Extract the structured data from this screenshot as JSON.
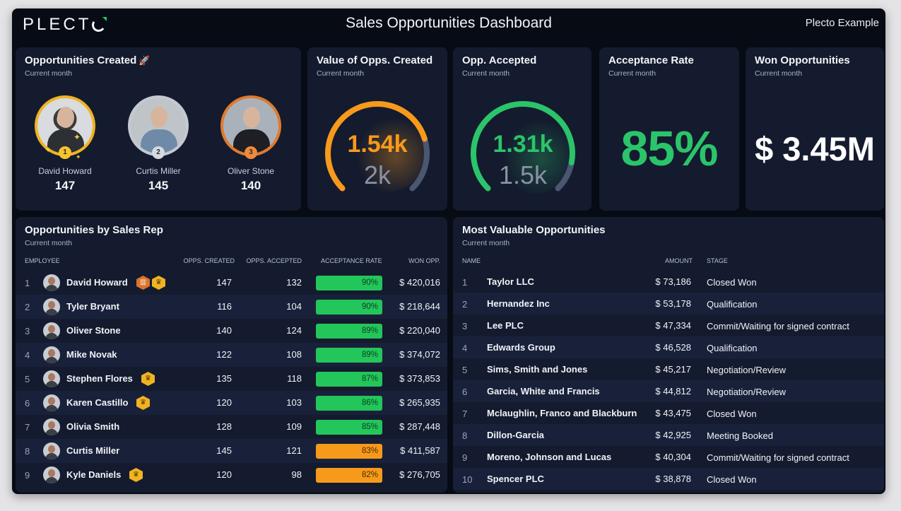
{
  "header": {
    "logo": "PLECT",
    "title": "Sales Opportunities Dashboard",
    "account": "Plecto Example",
    "accent_color": "#2bc46a"
  },
  "opps_created": {
    "title": "Opportunities Created",
    "title_icon": "rocket-icon",
    "subtitle": "Current month",
    "podium": [
      {
        "rank": "1",
        "name": "David Howard",
        "value": "147",
        "medal": "gold"
      },
      {
        "rank": "2",
        "name": "Curtis Miller",
        "value": "145",
        "medal": "silver"
      },
      {
        "rank": "3",
        "name": "Oliver Stone",
        "value": "140",
        "medal": "bronze"
      }
    ]
  },
  "value_created": {
    "title": "Value of Opps. Created",
    "subtitle": "Current month",
    "value": "1.54k",
    "target": "2k",
    "progress": 0.77,
    "color": "#f79a1b"
  },
  "opp_accepted": {
    "title": "Opp. Accepted",
    "subtitle": "Current month",
    "value": "1.31k",
    "target": "1.5k",
    "progress": 0.873,
    "color": "#2bc46a"
  },
  "acceptance_rate": {
    "title": "Acceptance Rate",
    "subtitle": "Current month",
    "value": "85%"
  },
  "won_opps": {
    "title": "Won Opportunities",
    "subtitle": "Current month",
    "value": "$ 3.45M"
  },
  "reps_table": {
    "title": "Opportunities by Sales Rep",
    "subtitle": "Current month",
    "columns": [
      "EMPLOYEE",
      "OPPS. CREATED",
      "OPPS. ACCEPTED",
      "ACCEPTANCE RATE",
      "WON OPP."
    ],
    "rows": [
      {
        "idx": "1",
        "name": "David Howard",
        "badges": [
          "cake",
          "trophy"
        ],
        "created": "147",
        "accepted": "132",
        "rate": "90%",
        "rate_status": "green",
        "won": "$ 420,016"
      },
      {
        "idx": "2",
        "name": "Tyler Bryant",
        "badges": [],
        "created": "116",
        "accepted": "104",
        "rate": "90%",
        "rate_status": "green",
        "won": "$ 218,644"
      },
      {
        "idx": "3",
        "name": "Oliver Stone",
        "badges": [],
        "created": "140",
        "accepted": "124",
        "rate": "89%",
        "rate_status": "green",
        "won": "$ 220,040"
      },
      {
        "idx": "4",
        "name": "Mike Novak",
        "badges": [],
        "created": "122",
        "accepted": "108",
        "rate": "89%",
        "rate_status": "green",
        "won": "$ 374,072"
      },
      {
        "idx": "5",
        "name": "Stephen Flores",
        "badges": [
          "trophy"
        ],
        "created": "135",
        "accepted": "118",
        "rate": "87%",
        "rate_status": "green",
        "won": "$ 373,853"
      },
      {
        "idx": "6",
        "name": "Karen Castillo",
        "badges": [
          "trophy"
        ],
        "created": "120",
        "accepted": "103",
        "rate": "86%",
        "rate_status": "green",
        "won": "$ 265,935"
      },
      {
        "idx": "7",
        "name": "Olivia Smith",
        "badges": [],
        "created": "128",
        "accepted": "109",
        "rate": "85%",
        "rate_status": "green",
        "won": "$ 287,448"
      },
      {
        "idx": "8",
        "name": "Curtis Miller",
        "badges": [],
        "created": "145",
        "accepted": "121",
        "rate": "83%",
        "rate_status": "orange",
        "won": "$ 411,587"
      },
      {
        "idx": "9",
        "name": "Kyle Daniels",
        "badges": [
          "trophy"
        ],
        "created": "120",
        "accepted": "98",
        "rate": "82%",
        "rate_status": "orange",
        "won": "$ 276,705"
      }
    ]
  },
  "opps_table": {
    "title": "Most Valuable Opportunities",
    "subtitle": "Current month",
    "columns": [
      "NAME",
      "AMOUNT",
      "STAGE"
    ],
    "rows": [
      {
        "idx": "1",
        "name": "Taylor LLC",
        "amount": "$ 73,186",
        "stage": "Closed Won"
      },
      {
        "idx": "2",
        "name": "Hernandez Inc",
        "amount": "$ 53,178",
        "stage": "Qualification"
      },
      {
        "idx": "3",
        "name": "Lee PLC",
        "amount": "$ 47,334",
        "stage": "Commit/Waiting for signed contract"
      },
      {
        "idx": "4",
        "name": "Edwards Group",
        "amount": "$ 46,528",
        "stage": "Qualification"
      },
      {
        "idx": "5",
        "name": "Sims, Smith and Jones",
        "amount": "$ 45,217",
        "stage": "Negotiation/Review"
      },
      {
        "idx": "6",
        "name": "Garcia, White and Francis",
        "amount": "$ 44,812",
        "stage": "Negotiation/Review"
      },
      {
        "idx": "7",
        "name": "Mclaughlin, Franco and Blackburn",
        "amount": "$ 43,475",
        "stage": "Closed Won"
      },
      {
        "idx": "8",
        "name": "Dillon-Garcia",
        "amount": "$ 42,925",
        "stage": "Meeting Booked"
      },
      {
        "idx": "9",
        "name": "Moreno, Johnson and Lucas",
        "amount": "$ 40,304",
        "stage": "Commit/Waiting for signed contract"
      },
      {
        "idx": "10",
        "name": "Spencer PLC",
        "amount": "$ 38,878",
        "stage": "Closed Won"
      }
    ]
  }
}
